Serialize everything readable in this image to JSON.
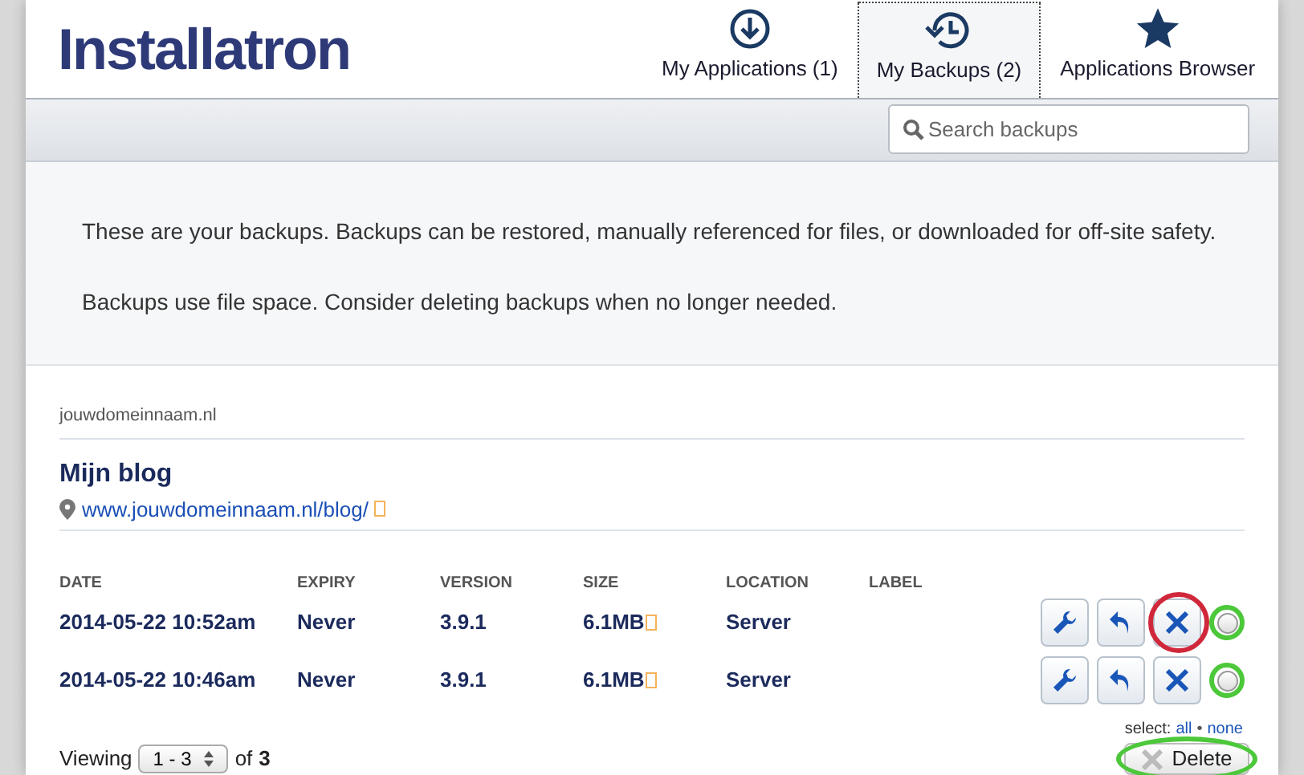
{
  "logo": "Installatron",
  "tabs": [
    {
      "label": "My Applications (1)",
      "selected": false
    },
    {
      "label": "My Backups (2)",
      "selected": true
    },
    {
      "label": "Applications Browser",
      "selected": false
    }
  ],
  "search": {
    "placeholder": "Search backups"
  },
  "info": [
    "These are your backups. Backups can be restored, manually referenced for files, or downloaded for off-site safety.",
    "Backups use file space. Consider deleting backups when no longer needed."
  ],
  "domain": "jouwdomeinnaam.nl",
  "app": {
    "title": "Mijn blog",
    "url": "www.jouwdomeinnaam.nl/blog/"
  },
  "table": {
    "columns": [
      "DATE",
      "EXPIRY",
      "VERSION",
      "SIZE",
      "LOCATION",
      "LABEL"
    ],
    "rows": [
      {
        "date": "2014-05-22 10:52am",
        "expiry": "Never",
        "version": "3.9.1",
        "size": "6.1MB",
        "location": "Server",
        "delete_circled": true,
        "checkbox_circled": true,
        "checked": false
      },
      {
        "date": "2014-05-22 10:46am",
        "expiry": "Never",
        "version": "3.9.1",
        "size": "6.1MB",
        "location": "Server",
        "delete_circled": false,
        "checkbox_circled": true,
        "checked": false
      }
    ]
  },
  "select": {
    "label": "select:",
    "all": "all",
    "separator": "•",
    "none": "none"
  },
  "pager": {
    "prefix": "Viewing",
    "range": "1 - 3",
    "of": "of",
    "total": "3"
  },
  "delete_button": {
    "label": "Delete",
    "disabled": true,
    "circled": true
  }
}
